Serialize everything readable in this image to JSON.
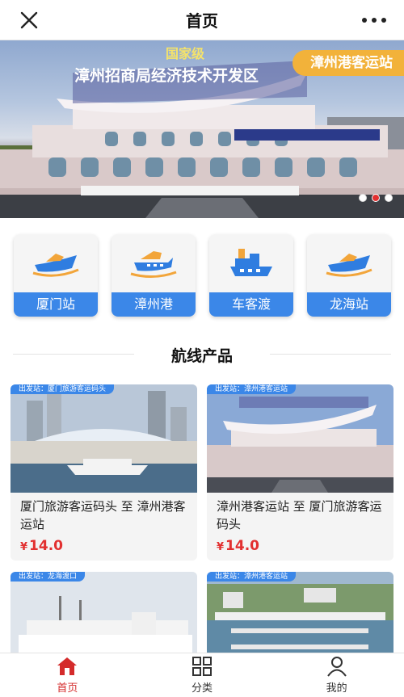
{
  "header": {
    "title": "首页",
    "close_icon": "close-icon",
    "more_icon": "more-dots-icon"
  },
  "banner": {
    "tag": "漳州港客运站",
    "sign_line1": "国家级",
    "sign_line2": "漳州招商局经济技术开发区",
    "active_slide": 2,
    "slide_count": 3
  },
  "categories": [
    {
      "label": "厦门站",
      "icon": "speedboat-icon"
    },
    {
      "label": "漳州港",
      "icon": "yacht-icon"
    },
    {
      "label": "车客渡",
      "icon": "ferry-icon"
    },
    {
      "label": "龙海站",
      "icon": "speedboat-icon"
    }
  ],
  "section": {
    "title": "航线产品"
  },
  "products": [
    {
      "name": "厦门旅游客运码头 至 漳州港客运站",
      "price_symbol": "¥",
      "price": "14.0",
      "chip": "出发站：厦门旅游客运码头"
    },
    {
      "name": "漳州港客运站 至 厦门旅游客运码头",
      "price_symbol": "¥",
      "price": "14.0",
      "chip": "出发站：漳州港客运站"
    },
    {
      "name": "",
      "price_symbol": "",
      "price": "",
      "chip": "出发站：龙海渡口"
    },
    {
      "name": "",
      "price_symbol": "",
      "price": "",
      "chip": "出发站：漳州港客运站"
    }
  ],
  "tabs": [
    {
      "label": "首页",
      "icon": "home-icon",
      "active": true
    },
    {
      "label": "分类",
      "icon": "grid-icon",
      "active": false
    },
    {
      "label": "我的",
      "icon": "user-icon",
      "active": false
    }
  ],
  "colors": {
    "accent": "#3b87e8",
    "price": "#e23030",
    "tag": "#f2b23a",
    "tab_active": "#d42b2b"
  }
}
